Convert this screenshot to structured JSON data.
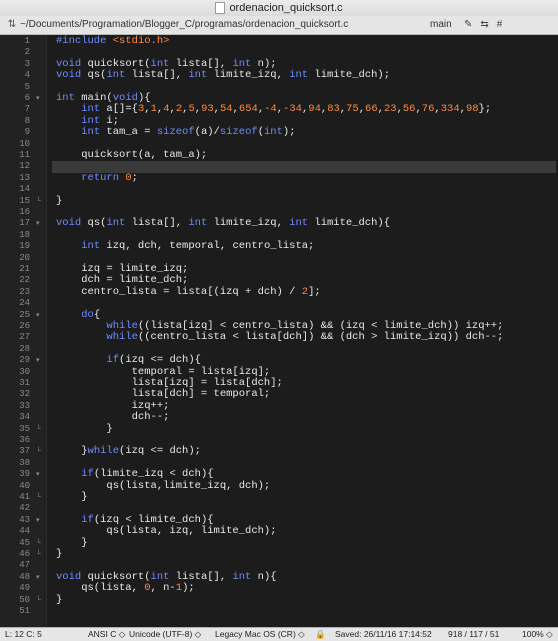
{
  "window": {
    "title": "ordenacion_quicksort.c",
    "path": "~/Documents/Programation/Blogger_C/programas/ordenacion_quicksort.c",
    "branch": "main",
    "icons": [
      "navigation-arrows-icon",
      "branch-icon",
      "edit-icon",
      "counterpart-icon",
      "hash-icon"
    ]
  },
  "editor": {
    "current_line": 12,
    "lines": [
      {
        "n": "1",
        "fold": "",
        "t": "<span class='pp'>#include</span> <span class='str'>&lt;stdio.h&gt;</span>"
      },
      {
        "n": "2",
        "fold": "",
        "t": ""
      },
      {
        "n": "3",
        "fold": "",
        "t": "<span class='kw'>void</span> quicksort(<span class='kw'>int</span> lista[], <span class='kw'>int</span> n);"
      },
      {
        "n": "4",
        "fold": "",
        "t": "<span class='kw'>void</span> qs(<span class='kw'>int</span> lista[], <span class='kw'>int</span> limite_izq, <span class='kw'>int</span> limite_dch);"
      },
      {
        "n": "5",
        "fold": "",
        "t": ""
      },
      {
        "n": "6",
        "fold": "▾",
        "t": "<span class='kw'>int</span> main(<span class='kw'>void</span>){"
      },
      {
        "n": "7",
        "fold": "",
        "t": "    <span class='kw'>int</span> a[]={<span class='num'>3</span>,<span class='num'>1</span>,<span class='num'>4</span>,<span class='num'>2</span>,<span class='num'>5</span>,<span class='num'>93</span>,<span class='num'>54</span>,<span class='num'>654</span>,<span class='num'>-4</span>,<span class='num'>-34</span>,<span class='num'>94</span>,<span class='num'>83</span>,<span class='num'>75</span>,<span class='num'>66</span>,<span class='num'>23</span>,<span class='num'>56</span>,<span class='num'>76</span>,<span class='num'>334</span>,<span class='num'>98</span>};"
      },
      {
        "n": "8",
        "fold": "",
        "t": "    <span class='kw'>int</span> i;"
      },
      {
        "n": "9",
        "fold": "",
        "t": "    <span class='kw'>int</span> tam_a = <span class='kw'>sizeof</span>(a)/<span class='kw'>sizeof</span>(<span class='kw'>int</span>);"
      },
      {
        "n": "10",
        "fold": "",
        "t": ""
      },
      {
        "n": "11",
        "fold": "",
        "t": "    quicksort(a, tam_a);"
      },
      {
        "n": "12",
        "fold": "",
        "t": ""
      },
      {
        "n": "13",
        "fold": "",
        "t": "    <span class='kw'>return</span> <span class='num'>0</span>;"
      },
      {
        "n": "14",
        "fold": "",
        "t": ""
      },
      {
        "n": "15",
        "fold": "└",
        "t": "}"
      },
      {
        "n": "16",
        "fold": "",
        "t": ""
      },
      {
        "n": "17",
        "fold": "▾",
        "t": "<span class='kw'>void</span> qs(<span class='kw'>int</span> lista[], <span class='kw'>int</span> limite_izq, <span class='kw'>int</span> limite_dch){"
      },
      {
        "n": "18",
        "fold": "",
        "t": ""
      },
      {
        "n": "19",
        "fold": "",
        "t": "    <span class='kw'>int</span> izq, dch, temporal, centro_lista;"
      },
      {
        "n": "20",
        "fold": "",
        "t": ""
      },
      {
        "n": "21",
        "fold": "",
        "t": "    izq = limite_izq;"
      },
      {
        "n": "22",
        "fold": "",
        "t": "    dch = limite_dch;"
      },
      {
        "n": "23",
        "fold": "",
        "t": "    centro_lista = lista[(izq + dch) / <span class='num'>2</span>];"
      },
      {
        "n": "24",
        "fold": "",
        "t": ""
      },
      {
        "n": "25",
        "fold": "▾",
        "t": "    <span class='kw'>do</span>{"
      },
      {
        "n": "26",
        "fold": "",
        "t": "        <span class='kw'>while</span>((lista[izq] &lt; centro_lista) &amp;&amp; (izq &lt; limite_dch)) izq++;"
      },
      {
        "n": "27",
        "fold": "",
        "t": "        <span class='kw'>while</span>((centro_lista &lt; lista[dch]) &amp;&amp; (dch &gt; limite_izq)) dch--;"
      },
      {
        "n": "28",
        "fold": "",
        "t": ""
      },
      {
        "n": "29",
        "fold": "▾",
        "t": "        <span class='kw'>if</span>(izq &lt;= dch){"
      },
      {
        "n": "30",
        "fold": "",
        "t": "            temporal = lista[izq];"
      },
      {
        "n": "31",
        "fold": "",
        "t": "            lista[izq] = lista[dch];"
      },
      {
        "n": "32",
        "fold": "",
        "t": "            lista[dch] = temporal;"
      },
      {
        "n": "33",
        "fold": "",
        "t": "            izq++;"
      },
      {
        "n": "34",
        "fold": "",
        "t": "            dch--;"
      },
      {
        "n": "35",
        "fold": "└",
        "t": "        }"
      },
      {
        "n": "36",
        "fold": "",
        "t": ""
      },
      {
        "n": "37",
        "fold": "└",
        "t": "    }<span class='kw'>while</span>(izq &lt;= dch);"
      },
      {
        "n": "38",
        "fold": "",
        "t": ""
      },
      {
        "n": "39",
        "fold": "▾",
        "t": "    <span class='kw'>if</span>(limite_izq &lt; dch){"
      },
      {
        "n": "40",
        "fold": "",
        "t": "        qs(lista,limite_izq, dch);"
      },
      {
        "n": "41",
        "fold": "└",
        "t": "    }"
      },
      {
        "n": "42",
        "fold": "",
        "t": ""
      },
      {
        "n": "43",
        "fold": "▾",
        "t": "    <span class='kw'>if</span>(izq &lt; limite_dch){"
      },
      {
        "n": "44",
        "fold": "",
        "t": "        qs(lista, izq, limite_dch);"
      },
      {
        "n": "45",
        "fold": "└",
        "t": "    }"
      },
      {
        "n": "46",
        "fold": "└",
        "t": "}"
      },
      {
        "n": "47",
        "fold": "",
        "t": ""
      },
      {
        "n": "48",
        "fold": "▾",
        "t": "<span class='kw'>void</span> quicksort(<span class='kw'>int</span> lista[], <span class='kw'>int</span> n){"
      },
      {
        "n": "49",
        "fold": "",
        "t": "    qs(lista, <span class='num'>0</span>, n-<span class='num'>1</span>);"
      },
      {
        "n": "50",
        "fold": "└",
        "t": "}"
      },
      {
        "n": "51",
        "fold": "",
        "t": ""
      }
    ]
  },
  "status": {
    "position": "L: 12 C: 5",
    "syntax": "ANSI C ◇",
    "encoding": "Unicode (UTF-8) ◇",
    "line_endings": "Legacy Mac OS (CR) ◇",
    "lock_icon": "lock-icon",
    "saved": "Saved: 26/11/16 17:14:52",
    "counts": "918 / 117 / 51",
    "zoom": "100% ◇"
  }
}
